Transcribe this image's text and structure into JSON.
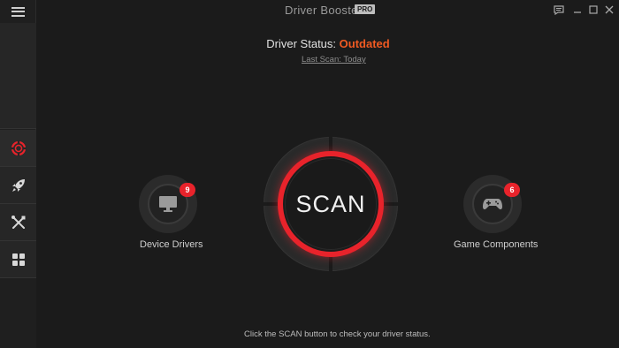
{
  "window": {
    "title": "Driver Booster 7",
    "edition_badge": "PRO"
  },
  "sidebar": {
    "menu_icon": "hamburger-menu-icon",
    "items": [
      {
        "icon": "lifebuoy-icon",
        "active": true
      },
      {
        "icon": "rocket-icon",
        "active": false
      },
      {
        "icon": "tools-icon",
        "active": false
      },
      {
        "icon": "grid-icon",
        "active": false
      }
    ]
  },
  "status": {
    "label": "Driver Status:",
    "value": "Outdated",
    "value_color": "#f05a22",
    "last_scan": "Last Scan: Today"
  },
  "scan": {
    "label": "SCAN",
    "ring_color": "#e8232b"
  },
  "device_drivers": {
    "label": "Device Drivers",
    "count": "9",
    "icon": "monitor-icon"
  },
  "game_components": {
    "label": "Game Components",
    "count": "6",
    "icon": "gamepad-icon"
  },
  "hint": "Click the SCAN button to check your driver status."
}
